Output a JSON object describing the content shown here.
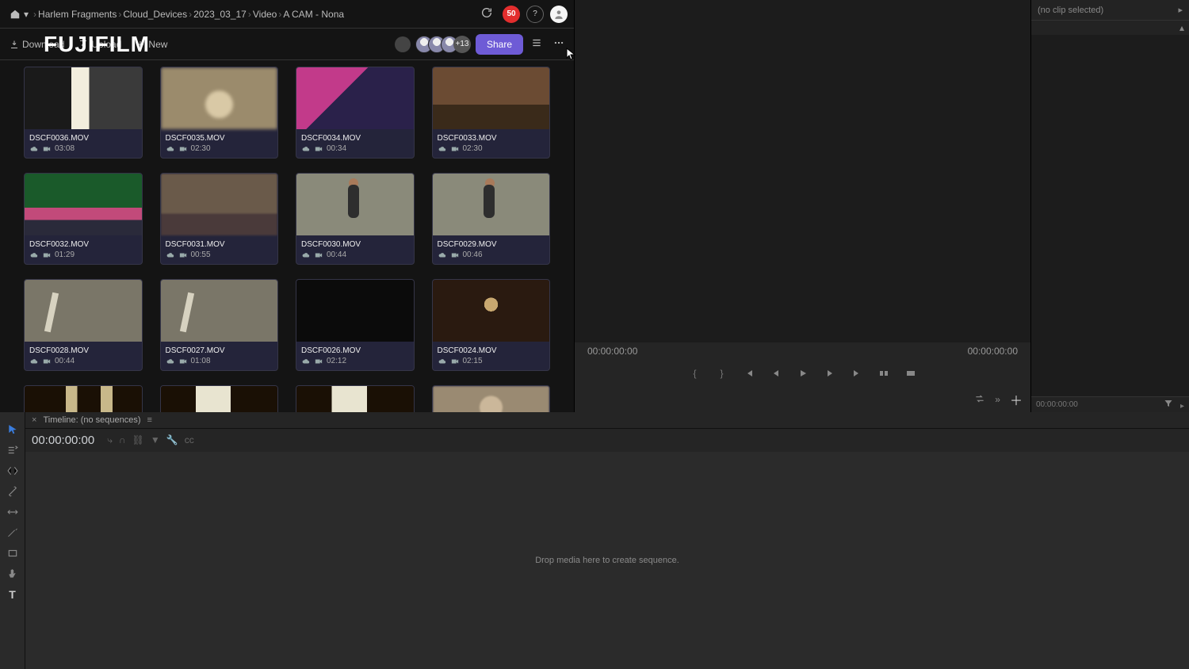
{
  "breadcrumb": {
    "items": [
      "Harlem Fragments",
      "Cloud_Devices",
      "2023_03_17",
      "Video",
      "A CAM - Nona"
    ],
    "badge": "50",
    "help": "?"
  },
  "actions": {
    "download": "Download",
    "upload": "Upload",
    "new": "New",
    "share": "Share",
    "collab_extra": "+13",
    "watermark": "FUJIFILM"
  },
  "clips": [
    {
      "name": "DSCF0036.MOV",
      "dur": "03:08",
      "thumb": "t-window"
    },
    {
      "name": "DSCF0035.MOV",
      "dur": "02:30",
      "thumb": "t-hand"
    },
    {
      "name": "DSCF0034.MOV",
      "dur": "00:34",
      "thumb": "t-stairs"
    },
    {
      "name": "DSCF0033.MOV",
      "dur": "02:30",
      "thumb": "t-door"
    },
    {
      "name": "DSCF0032.MOV",
      "dur": "01:29",
      "thumb": "t-green"
    },
    {
      "name": "DSCF0031.MOV",
      "dur": "00:55",
      "thumb": "t-room"
    },
    {
      "name": "DSCF0030.MOV",
      "dur": "00:44",
      "thumb": "t-boy"
    },
    {
      "name": "DSCF0029.MOV",
      "dur": "00:46",
      "thumb": "t-boy"
    },
    {
      "name": "DSCF0028.MOV",
      "dur": "00:44",
      "thumb": "t-wall"
    },
    {
      "name": "DSCF0027.MOV",
      "dur": "01:08",
      "thumb": "t-wall"
    },
    {
      "name": "DSCF0026.MOV",
      "dur": "02:12",
      "thumb": "t-dark"
    },
    {
      "name": "DSCF0024.MOV",
      "dur": "02:15",
      "thumb": "t-hall"
    },
    {
      "name": "",
      "dur": "",
      "thumb": "t-corr",
      "partial": true
    },
    {
      "name": "",
      "dur": "",
      "thumb": "t-win2",
      "partial": true
    },
    {
      "name": "",
      "dur": "",
      "thumb": "t-win2",
      "partial": true
    },
    {
      "name": "",
      "dur": "",
      "thumb": "t-face",
      "partial": true
    }
  ],
  "viewer": {
    "tc_left": "00:00:00:00",
    "tc_right": "00:00:00:00"
  },
  "side": {
    "title": "(no clip selected)",
    "foot_tc": "00:00:00:00"
  },
  "timeline": {
    "tab": "Timeline: (no sequences)",
    "tc": "00:00:00:00",
    "hint": "Drop media here to create sequence."
  }
}
